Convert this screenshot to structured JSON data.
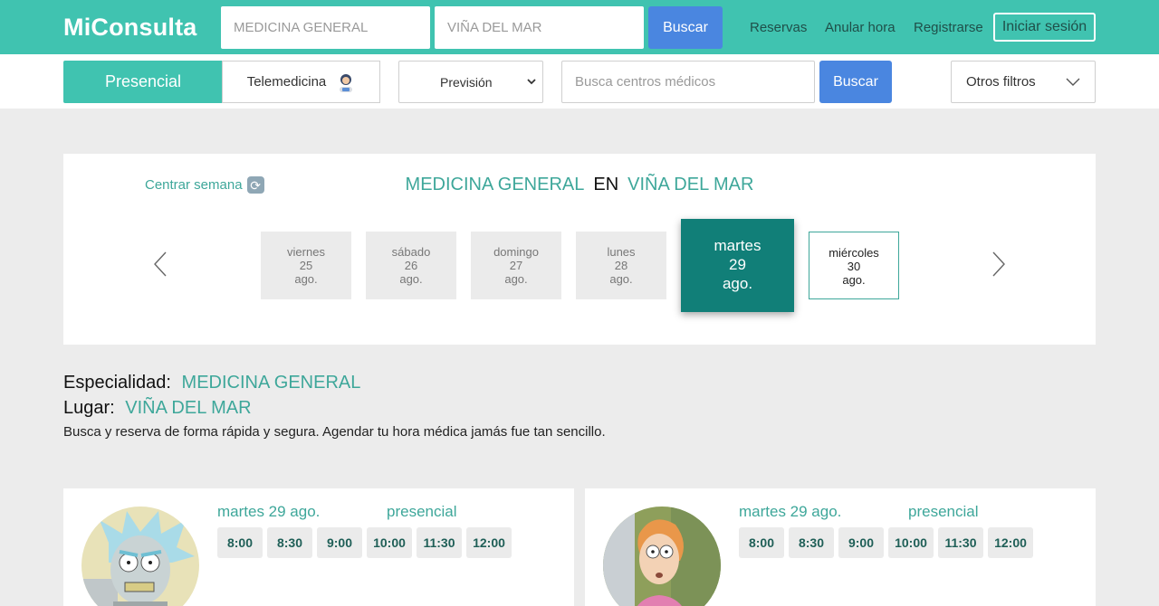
{
  "header": {
    "logo": "MiConsulta",
    "specialty_placeholder": "MEDICINA GENERAL",
    "location_placeholder": "VIÑA DEL MAR",
    "search_label": "Buscar",
    "nav": [
      "Reservas",
      "Anular hora",
      "Registrarse"
    ],
    "login_label": "Iniciar sesión"
  },
  "filters": {
    "presencial": "Presencial",
    "telemedicina": "Telemedicina",
    "prevision": "Previsión",
    "centros_placeholder": "Busca centros médicos",
    "search_label": "Buscar",
    "otros": "Otros filtros"
  },
  "week": {
    "centrar": "Centrar semana",
    "specialty": "MEDICINA GENERAL",
    "en": "EN",
    "location": "VIÑA DEL MAR",
    "days": [
      {
        "name": "viernes",
        "num": "25",
        "month": "ago."
      },
      {
        "name": "sábado",
        "num": "26",
        "month": "ago."
      },
      {
        "name": "domingo",
        "num": "27",
        "month": "ago."
      },
      {
        "name": "lunes",
        "num": "28",
        "month": "ago."
      },
      {
        "name": "martes",
        "num": "29",
        "month": "ago."
      },
      {
        "name": "miércoles",
        "num": "30",
        "month": "ago."
      }
    ]
  },
  "info": {
    "especialidad_label": "Especialidad:",
    "especialidad": "MEDICINA GENERAL",
    "lugar_label": "Lugar:",
    "lugar": "VIÑA DEL MAR",
    "description": "Busca y reserva de forma rápida y segura. Agendar tu hora médica jamás fue tan sencillo."
  },
  "doctors": [
    {
      "date": "martes 29 ago.",
      "mode": "presencial",
      "slots": [
        "8:00",
        "8:30",
        "9:00",
        "10:00",
        "11:30",
        "12:00"
      ]
    },
    {
      "date": "martes 29 ago.",
      "mode": "presencial",
      "slots": [
        "8:00",
        "8:30",
        "9:00",
        "10:00",
        "11:30",
        "12:00"
      ]
    }
  ],
  "colors": {
    "primary": "#40c3b0",
    "teal_text": "#3ea79a",
    "active_day": "#117f78",
    "button_blue": "#4a86e0"
  }
}
